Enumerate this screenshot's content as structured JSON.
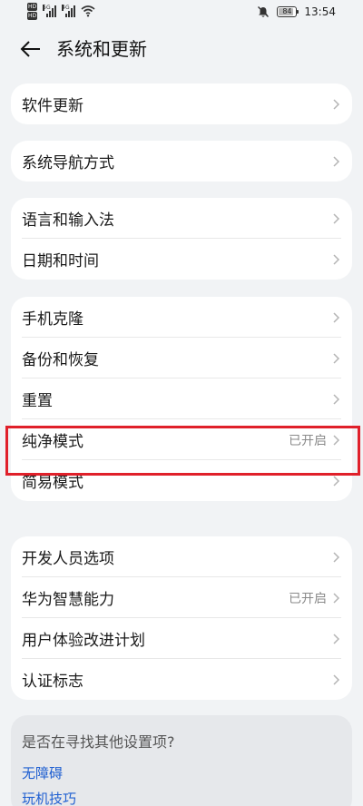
{
  "status_bar": {
    "hd1": "HD",
    "hd2": "HD",
    "sim1": "5G",
    "sim2": "4G",
    "battery": "84",
    "battery_level": 0.84,
    "time": "13:54"
  },
  "header": {
    "title": "系统和更新"
  },
  "groups": [
    {
      "items": [
        {
          "label": "软件更新",
          "value": ""
        }
      ]
    },
    {
      "items": [
        {
          "label": "系统导航方式",
          "value": ""
        }
      ]
    },
    {
      "items": [
        {
          "label": "语言和输入法",
          "value": ""
        },
        {
          "label": "日期和时间",
          "value": ""
        }
      ]
    },
    {
      "items": [
        {
          "label": "手机克隆",
          "value": ""
        },
        {
          "label": "备份和恢复",
          "value": ""
        },
        {
          "label": "重置",
          "value": ""
        },
        {
          "label": "纯净模式",
          "value": "已开启"
        },
        {
          "label": "简易模式",
          "value": ""
        }
      ]
    },
    {
      "items": [
        {
          "label": "开发人员选项",
          "value": ""
        },
        {
          "label": "华为智慧能力",
          "value": "已开启"
        },
        {
          "label": "用户体验改进计划",
          "value": ""
        },
        {
          "label": "认证标志",
          "value": ""
        }
      ]
    }
  ],
  "help": {
    "title": "是否在寻找其他设置项?",
    "links": [
      "无障碍",
      "玩机技巧"
    ]
  },
  "colors": {
    "highlight": "#e0202a",
    "link": "#1f5fd1"
  }
}
